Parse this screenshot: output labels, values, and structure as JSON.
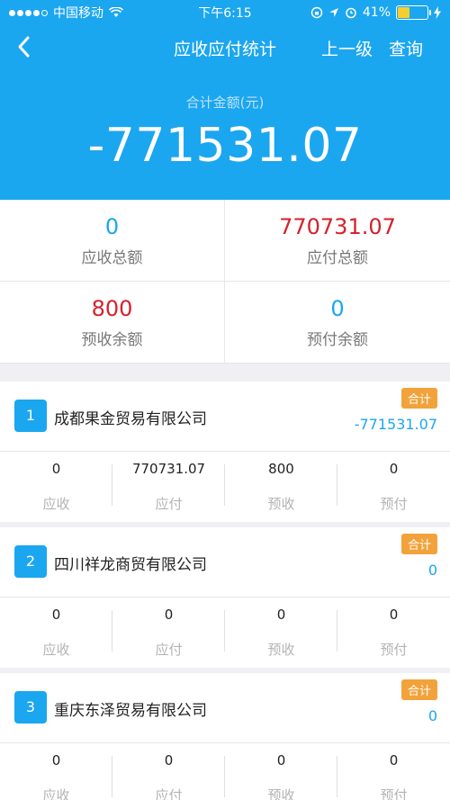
{
  "status_bar": {
    "carrier": "中国移动",
    "time": "下午6:15",
    "battery": "41%",
    "battery_level": 0.41
  },
  "nav": {
    "title": "应收应付统计",
    "up_level": "上一级",
    "query": "查询"
  },
  "total": {
    "label": "合计金额(元)",
    "value": "-771531.07"
  },
  "summary": {
    "receivable_total": {
      "value": "0",
      "label": "应收总额"
    },
    "payable_total": {
      "value": "770731.07",
      "label": "应付总额"
    },
    "prereceived_balance": {
      "value": "800",
      "label": "预收余额"
    },
    "prepaid_balance": {
      "value": "0",
      "label": "预付余额"
    }
  },
  "colors": {
    "accent": "#1ba6f0",
    "negative": "#d5212a",
    "tag": "#f2a23a"
  },
  "companies": [
    {
      "index": "1",
      "name": "成都果金贸易有限公司",
      "tag": "合计",
      "amount": "-771531.07",
      "stats": [
        {
          "value": "0",
          "label": "应收"
        },
        {
          "value": "770731.07",
          "label": "应付"
        },
        {
          "value": "800",
          "label": "预收"
        },
        {
          "value": "0",
          "label": "预付"
        }
      ]
    },
    {
      "index": "2",
      "name": "四川祥龙商贸有限公司",
      "tag": "合计",
      "amount": "0",
      "stats": [
        {
          "value": "0",
          "label": "应收"
        },
        {
          "value": "0",
          "label": "应付"
        },
        {
          "value": "0",
          "label": "预收"
        },
        {
          "value": "0",
          "label": "预付"
        }
      ]
    },
    {
      "index": "3",
      "name": "重庆东泽贸易有限公司",
      "tag": "合计",
      "amount": "0",
      "stats": [
        {
          "value": "0",
          "label": "应收"
        },
        {
          "value": "0",
          "label": "应付"
        },
        {
          "value": "0",
          "label": "预收"
        },
        {
          "value": "0",
          "label": "预付"
        }
      ]
    }
  ]
}
